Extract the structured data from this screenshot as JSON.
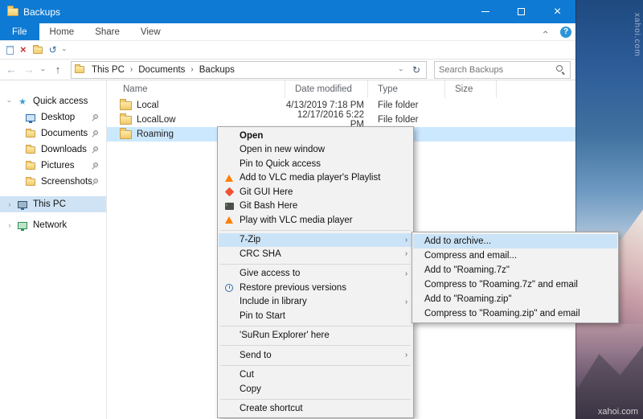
{
  "titlebar": {
    "title": "Backups"
  },
  "ribbon": {
    "tabs": [
      {
        "label": "File",
        "active": true
      },
      {
        "label": "Home"
      },
      {
        "label": "Share"
      },
      {
        "label": "View"
      }
    ]
  },
  "address": {
    "breadcrumb": [
      {
        "label": "This PC"
      },
      {
        "label": "Documents"
      },
      {
        "label": "Backups"
      }
    ],
    "search_placeholder": "Search Backups"
  },
  "sidebar": {
    "quick_access_label": "Quick access",
    "quick_items": [
      {
        "label": "Desktop",
        "icon": "monitor"
      },
      {
        "label": "Documents",
        "icon": "folder"
      },
      {
        "label": "Downloads",
        "icon": "folder"
      },
      {
        "label": "Pictures",
        "icon": "folder"
      },
      {
        "label": "Screenshots",
        "icon": "folder"
      }
    ],
    "this_pc_label": "This PC",
    "network_label": "Network"
  },
  "filelist": {
    "columns": [
      {
        "label": "Name"
      },
      {
        "label": "Date modified"
      },
      {
        "label": "Type"
      },
      {
        "label": "Size"
      }
    ],
    "rows": [
      {
        "name": "Local",
        "date": "4/13/2019 7:18 PM",
        "type": "File folder",
        "size": ""
      },
      {
        "name": "LocalLow",
        "date": "12/17/2016 5:22 PM",
        "type": "File folder",
        "size": ""
      },
      {
        "name": "Roaming",
        "date": "",
        "type": "",
        "size": "",
        "selected": true
      }
    ]
  },
  "context_menu": {
    "items": [
      {
        "label": "Open",
        "bold": true
      },
      {
        "label": "Open in new window"
      },
      {
        "label": "Pin to Quick access"
      },
      {
        "label": "Add to VLC media player's Playlist",
        "icon": "vlc"
      },
      {
        "label": "Git GUI Here",
        "icon": "git-gui"
      },
      {
        "label": "Git Bash Here",
        "icon": "git-bash"
      },
      {
        "label": "Play with VLC media player",
        "icon": "vlc"
      },
      {
        "sep": true
      },
      {
        "label": "7-Zip",
        "submenu": true,
        "selected": true
      },
      {
        "label": "CRC SHA",
        "submenu": true
      },
      {
        "sep": true
      },
      {
        "label": "Give access to",
        "submenu": true
      },
      {
        "label": "Restore previous versions",
        "icon": "history"
      },
      {
        "label": "Include in library",
        "submenu": true
      },
      {
        "label": "Pin to Start"
      },
      {
        "sep": true
      },
      {
        "label": "'SuRun Explorer' here"
      },
      {
        "sep": true
      },
      {
        "label": "Send to",
        "submenu": true
      },
      {
        "sep": true
      },
      {
        "label": "Cut"
      },
      {
        "label": "Copy"
      },
      {
        "sep": true
      },
      {
        "label": "Create shortcut"
      }
    ]
  },
  "submenu_7zip": {
    "items": [
      {
        "label": "Add to archive...",
        "selected": true
      },
      {
        "label": "Compress and email..."
      },
      {
        "label": "Add to \"Roaming.7z\""
      },
      {
        "label": "Compress to \"Roaming.7z\" and email"
      },
      {
        "label": "Add to \"Roaming.zip\""
      },
      {
        "label": "Compress to \"Roaming.zip\" and email"
      }
    ]
  },
  "watermark": {
    "text": "xahoi.com"
  },
  "colors": {
    "accent": "#0e7ad3",
    "selection": "#cce8ff",
    "menu_highlight": "#cbe3f6",
    "menu_background": "#f2f2f2"
  }
}
